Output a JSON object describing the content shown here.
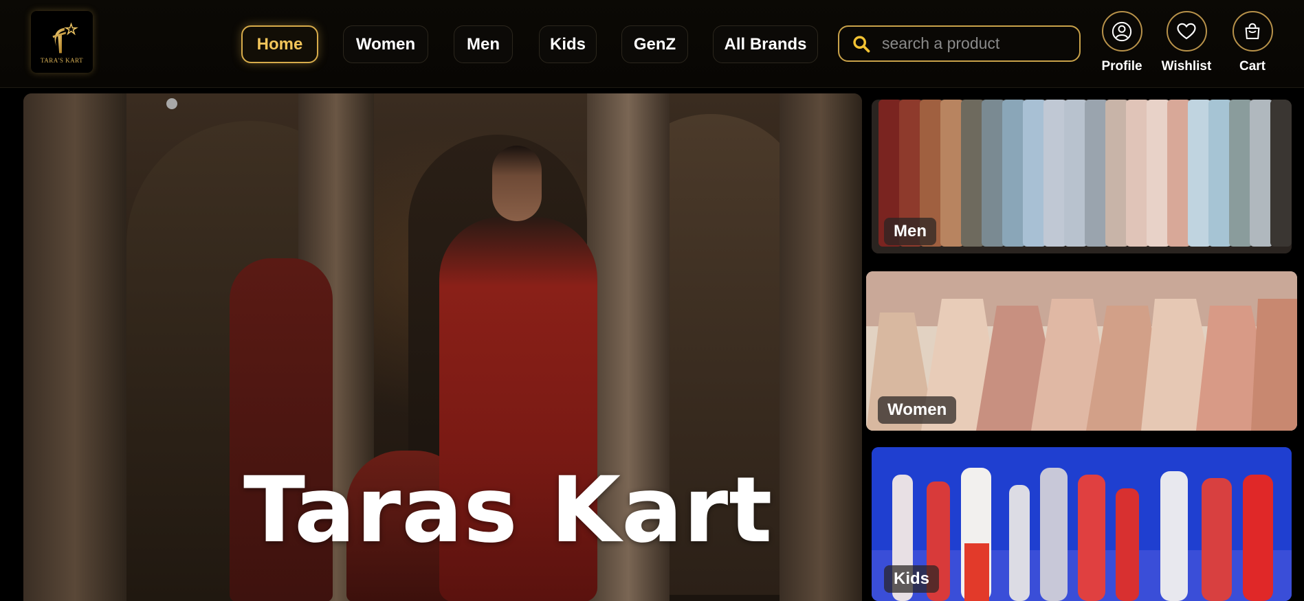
{
  "brand": {
    "logo_text": "TARA'S KART"
  },
  "nav": {
    "home": "Home",
    "women": "Women",
    "men": "Men",
    "kids": "Kids",
    "genz": "GenZ",
    "all_brands": "All Brands",
    "active": "Home"
  },
  "search": {
    "placeholder": "search a product",
    "icon": "search-icon"
  },
  "actions": {
    "profile": "Profile",
    "wishlist": "Wishlist",
    "cart": "Cart"
  },
  "hero": {
    "title": "Taras Kart"
  },
  "categories": [
    {
      "label": "Men"
    },
    {
      "label": "Women"
    },
    {
      "label": "Kids"
    }
  ],
  "colors": {
    "accent": "#d8ac4b",
    "background": "#000000"
  }
}
